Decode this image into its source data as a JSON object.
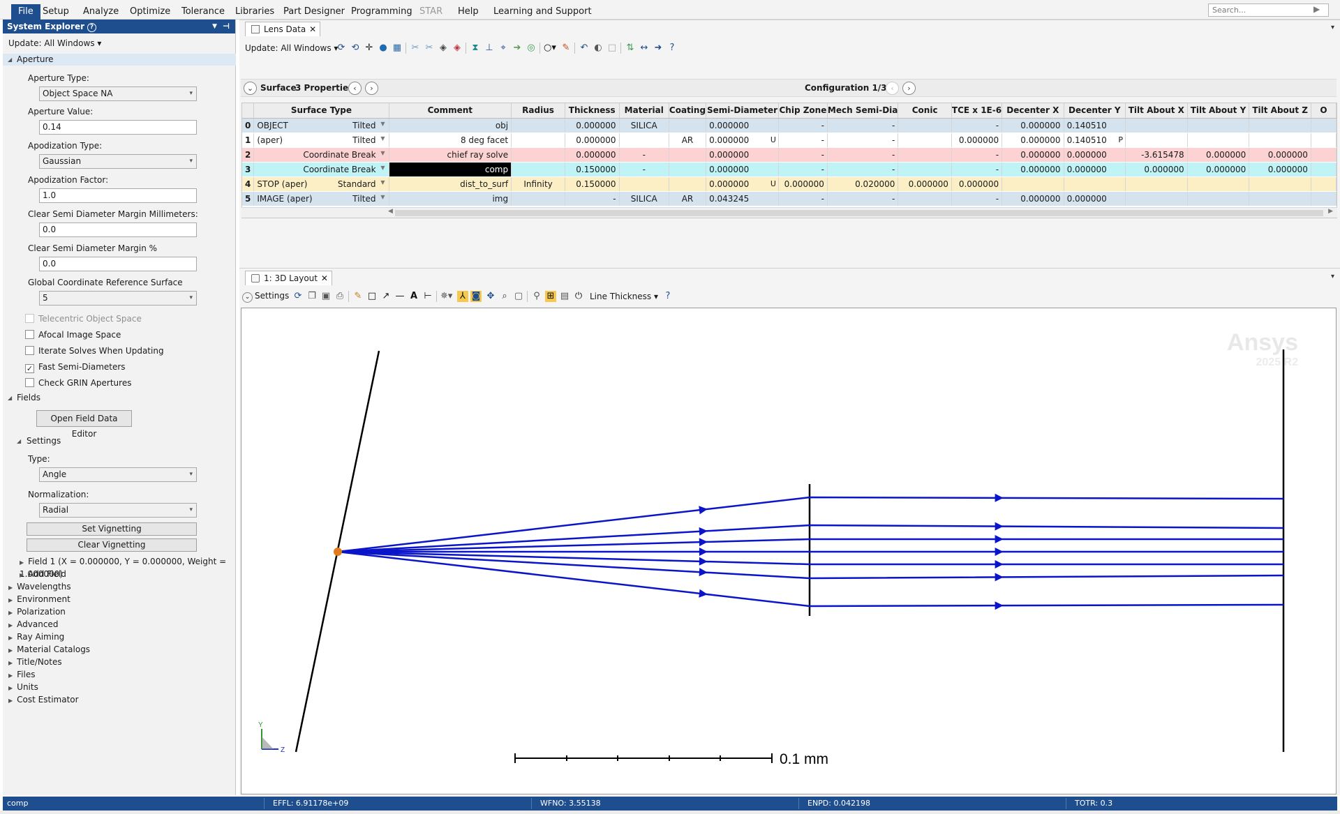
{
  "menubar": {
    "items": [
      "File",
      "Setup",
      "Analyze",
      "Optimize",
      "Tolerance",
      "Libraries",
      "Part Designer",
      "Programming",
      "STAR",
      "Help",
      "Learning and Support"
    ],
    "search_placeholder": "Search..."
  },
  "system_explorer": {
    "title": "System Explorer",
    "update": "Update: All Windows",
    "aperture": {
      "section": "Aperture",
      "aperture_type_label": "Aperture Type:",
      "aperture_type_value": "Object Space NA",
      "aperture_value_label": "Aperture Value:",
      "aperture_value": "0.14",
      "apodization_type_label": "Apodization Type:",
      "apodization_type_value": "Gaussian",
      "apodization_factor_label": "Apodization Factor:",
      "apodization_factor": "1.0",
      "clear_mm_label": "Clear Semi Diameter Margin Millimeters:",
      "clear_mm": "0.0",
      "clear_pct_label": "Clear Semi Diameter Margin %",
      "clear_pct": "0.0",
      "gcr_label": "Global Coordinate Reference Surface",
      "gcr_value": "5",
      "checks": [
        {
          "label": "Telecentric Object Space",
          "checked": false,
          "disabled": true
        },
        {
          "label": "Afocal Image Space",
          "checked": false,
          "disabled": false
        },
        {
          "label": "Iterate Solves When Updating",
          "checked": false,
          "disabled": false
        },
        {
          "label": "Fast Semi-Diameters",
          "checked": true,
          "disabled": false
        },
        {
          "label": "Check GRIN Apertures",
          "checked": false,
          "disabled": false
        }
      ]
    },
    "fields": {
      "section": "Fields",
      "open_editor": "Open Field Data Editor",
      "settings": "Settings",
      "type_label": "Type:",
      "type_value": "Angle",
      "norm_label": "Normalization:",
      "norm_value": "Radial",
      "set_vignetting": "Set Vignetting",
      "clear_vignetting": "Clear Vignetting",
      "field1": "Field 1 (X = 0.000000, Y = 0.000000, Weight = 1.000000)",
      "add_field": "Add Field"
    },
    "tree": [
      "Wavelengths",
      "Environment",
      "Polarization",
      "Advanced",
      "Ray Aiming",
      "Material Catalogs",
      "Title/Notes",
      "Files",
      "Units",
      "Cost Estimator"
    ]
  },
  "lens_data": {
    "tab": "Lens Data",
    "update": "Update: All Windows",
    "surface_label": "Surface",
    "properties": "3 Properties",
    "configuration": "Configuration 1/3",
    "columns": [
      "Surface Type",
      "Comment",
      "Radius",
      "Thickness",
      "Material",
      "Coating",
      "Semi-Diameter",
      "Chip Zone",
      "Mech Semi-Dia",
      "Conic",
      "TCE x 1E-6",
      "Decenter X",
      "Decenter Y",
      "Tilt About X",
      "Tilt About Y",
      "Tilt About Z",
      "O"
    ],
    "rows": [
      {
        "num": "0",
        "name": "OBJECT",
        "type": "Tilted",
        "comment": "obj",
        "radius": "",
        "thickness": "0.000000",
        "material": "SILICA",
        "coating": "",
        "semi": "0.000000",
        "semi_flag": "",
        "chip": "-",
        "mech": "-",
        "conic": "",
        "tce": "-",
        "dx": "0.000000",
        "dy": "0.140510",
        "dy_flag": "",
        "tx": "",
        "ty": "",
        "tz": ""
      },
      {
        "num": "1",
        "name": "(aper)",
        "type": "Tilted",
        "comment": "8 deg facet",
        "radius": "",
        "thickness": "0.000000",
        "material": "",
        "coating": "AR",
        "semi": "0.000000",
        "semi_flag": "U",
        "chip": "-",
        "mech": "-",
        "conic": "",
        "tce": "0.000000",
        "dx": "0.000000",
        "dy": "0.140510",
        "dy_flag": "P",
        "tx": "",
        "ty": "",
        "tz": ""
      },
      {
        "num": "2",
        "name": "",
        "type": "Coordinate Break",
        "comment": "chief ray solve",
        "radius": "",
        "thickness": "0.000000",
        "material": "-",
        "coating": "",
        "semi": "0.000000",
        "semi_flag": "",
        "chip": "-",
        "mech": "-",
        "conic": "",
        "tce": "-",
        "dx": "0.000000",
        "dy": "0.000000",
        "dy_flag": "",
        "tx": "-3.615478",
        "ty": "0.000000",
        "tz": "0.000000"
      },
      {
        "num": "3",
        "name": "",
        "type": "Coordinate Break",
        "comment": "comp",
        "radius": "",
        "thickness": "0.150000",
        "material": "-",
        "coating": "",
        "semi": "0.000000",
        "semi_flag": "",
        "chip": "-",
        "mech": "-",
        "conic": "",
        "tce": "-",
        "dx": "0.000000",
        "dy": "0.000000",
        "dy_flag": "",
        "tx": "0.000000",
        "ty": "0.000000",
        "tz": "0.000000"
      },
      {
        "num": "4",
        "name": "STOP (aper)",
        "type": "Standard",
        "comment": "dist_to_surf",
        "radius": "Infinity",
        "thickness": "0.150000",
        "material": "",
        "coating": "",
        "semi": "0.000000",
        "semi_flag": "U",
        "chip": "0.000000",
        "mech": "0.020000",
        "conic": "0.000000",
        "tce": "0.000000",
        "dx": "",
        "dy": "",
        "dy_flag": "",
        "tx": "",
        "ty": "",
        "tz": ""
      },
      {
        "num": "5",
        "name": "IMAGE (aper)",
        "type": "Tilted",
        "comment": "img",
        "radius": "",
        "thickness": "-",
        "material": "SILICA",
        "coating": "AR",
        "semi": "0.043245",
        "semi_flag": "",
        "chip": "-",
        "mech": "-",
        "conic": "",
        "tce": "-",
        "dx": "0.000000",
        "dy": "0.000000",
        "dy_flag": "",
        "tx": "",
        "ty": "",
        "tz": ""
      }
    ]
  },
  "layout3d": {
    "tab": "1: 3D Layout",
    "settings": "Settings",
    "line_thickness": "Line Thickness",
    "watermark_brand": "Ansys",
    "watermark_version": "2025 R2",
    "scale_label": "0.1 mm",
    "axis_y": "Y",
    "axis_z": "Z",
    "ray_color": "#0a14c8",
    "point_color": "#e07a1a"
  },
  "status": {
    "comment": "comp",
    "effl": "EFFL: 6.91178e+09",
    "wfno": "WFNO: 3.55138",
    "enpd": "ENPD: 0.042198",
    "totr": "TOTR: 0.3"
  }
}
